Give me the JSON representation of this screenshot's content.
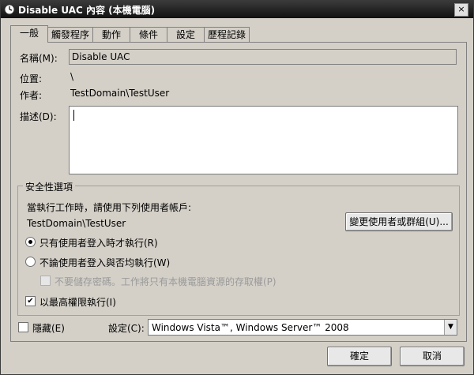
{
  "window": {
    "title": "Disable UAC 內容 (本機電腦)",
    "close_label": "×"
  },
  "tabs": [
    "一般",
    "觸發程序",
    "動作",
    "條件",
    "設定",
    "歷程記錄"
  ],
  "general": {
    "name_label": "名稱(M):",
    "name_value": "Disable UAC",
    "location_label": "位置:",
    "location_value": "\\",
    "author_label": "作者:",
    "author_value": "TestDomain\\TestUser",
    "description_label": "描述(D):"
  },
  "security": {
    "group_title": "安全性選項",
    "run_as_prompt": "當執行工作時，請使用下列使用者帳戶:",
    "account": "TestDomain\\TestUser",
    "change_user_button": "變更使用者或群組(U)...",
    "radio_logged_on": "只有使用者登入時才執行(R)",
    "radio_any": "不論使用者登入與否均執行(W)",
    "no_store_password": "不要儲存密碼。工作將只有本機電腦資源的存取權(P)",
    "highest_privileges": "以最高權限執行(I)"
  },
  "bottom": {
    "hidden_label": "隱藏(E)",
    "configure_label": "設定(C):",
    "configure_value": "Windows Vista™, Windows Server™ 2008"
  },
  "footer": {
    "ok_button": "確定",
    "cancel_button": "取消"
  },
  "state": {
    "selected_radio": "logged_on",
    "highest_privileges_checked": true,
    "hidden_checked": false
  }
}
